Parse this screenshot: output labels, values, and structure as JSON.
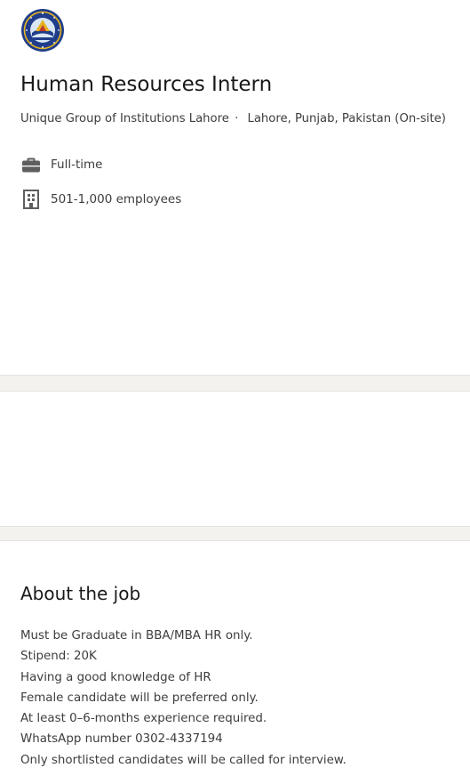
{
  "job": {
    "logo_icon": "company-logo",
    "title": "Human Resources Intern",
    "company": "Unique Group of Institutions Lahore",
    "separator": "·",
    "location": "Lahore, Punjab, Pakistan (On-site)",
    "insights": [
      {
        "icon": "briefcase-icon",
        "text": "Full-time"
      },
      {
        "icon": "building-icon",
        "text": "501-1,000 employees"
      }
    ]
  },
  "about": {
    "heading": "About the job",
    "lines": [
      "Must be Graduate in BBA/MBA HR only.",
      "Stipend: 20K",
      "Having a good knowledge of HR",
      "Female candidate will be preferred only.",
      "At least 0–6-months experience required.",
      "WhatsApp number 0302-4337194",
      "Only shortlisted candidates will be called for interview."
    ]
  },
  "colors": {
    "background": "#f3f2ef",
    "card": "#ffffff",
    "text_primary": "#191919",
    "text_secondary": "#3d3d3d",
    "icon": "#5e5e5e",
    "logo_blue": "#1f3d8a",
    "logo_gold": "#e6b422"
  }
}
